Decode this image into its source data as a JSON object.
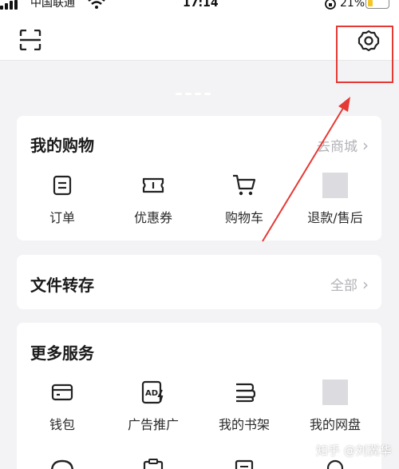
{
  "status_bar": {
    "carrier": "中国联通",
    "time": "17:14",
    "battery": "21%"
  },
  "top_bar": {
    "left_icon": "scan-icon",
    "right_icon": "settings-gear-icon"
  },
  "annotation": {
    "color": "#e53935"
  },
  "shopping": {
    "title": "我的购物",
    "link": "去商城",
    "items": [
      {
        "label": "订单",
        "icon": "order-icon"
      },
      {
        "label": "优惠券",
        "icon": "coupon-icon"
      },
      {
        "label": "购物车",
        "icon": "cart-icon"
      },
      {
        "label": "退款/售后",
        "icon": "refund-icon"
      }
    ]
  },
  "transfer": {
    "title": "文件转存",
    "link": "全部"
  },
  "services": {
    "title": "更多服务",
    "items": [
      {
        "label": "钱包",
        "icon": "wallet-icon"
      },
      {
        "label": "广告推广",
        "icon": "ad-promotion-icon"
      },
      {
        "label": "我的书架",
        "icon": "bookshelf-icon"
      },
      {
        "label": "我的网盘",
        "icon": "cloud-drive-icon"
      }
    ]
  },
  "watermark": {
    "text": "知乎 @刘冀华"
  }
}
